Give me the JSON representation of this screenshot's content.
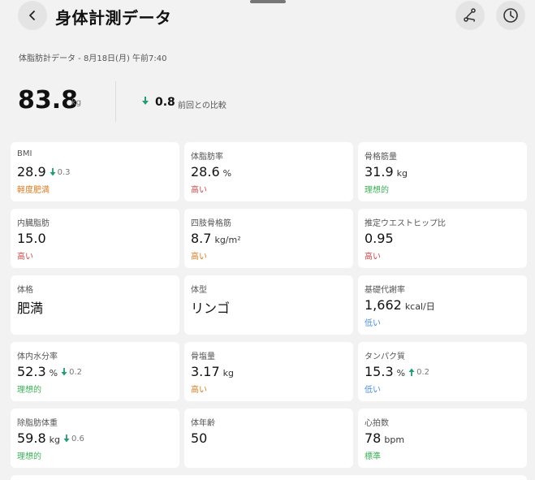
{
  "header": {
    "title": "身体計測データ",
    "back_icon": "chevron-left-icon",
    "route_icon": "route-icon",
    "history_icon": "history-icon"
  },
  "subtitle": "体脂肪計データ - 8月18日(月) 午前7:40",
  "summary": {
    "weight": "83.8",
    "unit": "kg",
    "diff": "0.8",
    "diff_direction": "down",
    "diff_label": "前回との比較"
  },
  "colors": {
    "orange": "#e07b1f",
    "red": "#d64545",
    "green": "#3daf58",
    "blue": "#4a90d9",
    "arrow_green": "#1d9e75"
  },
  "metrics": [
    {
      "label": "BMI",
      "value": "28.9",
      "unit": "",
      "change": "0.3",
      "change_dir": "down",
      "status": "軽度肥満",
      "status_color": "#e07b1f"
    },
    {
      "label": "体脂肪率",
      "value": "28.6",
      "unit": "%",
      "change": "",
      "change_dir": "",
      "status": "高い",
      "status_color": "#d64545"
    },
    {
      "label": "骨格筋量",
      "value": "31.9",
      "unit": "kg",
      "change": "",
      "change_dir": "",
      "status": "理想的",
      "status_color": "#3daf58"
    },
    {
      "label": "内臓脂肪",
      "value": "15.0",
      "unit": "",
      "change": "",
      "change_dir": "",
      "status": "高い",
      "status_color": "#d64545"
    },
    {
      "label": "四肢骨格筋",
      "value": "8.7",
      "unit": "kg/m²",
      "change": "",
      "change_dir": "",
      "status": "高い",
      "status_color": "#e07b1f"
    },
    {
      "label": "推定ウエストヒップ比",
      "value": "0.95",
      "unit": "",
      "change": "",
      "change_dir": "",
      "status": "高い",
      "status_color": "#d64545"
    },
    {
      "label": "体格",
      "value": "肥満",
      "unit": "",
      "change": "",
      "change_dir": "",
      "status": "",
      "status_color": ""
    },
    {
      "label": "体型",
      "value": "リンゴ",
      "unit": "",
      "change": "",
      "change_dir": "",
      "status": "",
      "status_color": ""
    },
    {
      "label": "基礎代謝率",
      "value": "1,662",
      "unit": "kcal/日",
      "change": "",
      "change_dir": "",
      "status": "低い",
      "status_color": "#4a90d9"
    },
    {
      "label": "体内水分率",
      "value": "52.3",
      "unit": "%",
      "change": "0.2",
      "change_dir": "down",
      "status": "理想的",
      "status_color": "#3daf58"
    },
    {
      "label": "骨塩量",
      "value": "3.17",
      "unit": "kg",
      "change": "",
      "change_dir": "",
      "status": "高い",
      "status_color": "#e07b1f"
    },
    {
      "label": "タンパク質",
      "value": "15.3",
      "unit": "%",
      "change": "0.2",
      "change_dir": "up",
      "status": "低い",
      "status_color": "#4a90d9"
    },
    {
      "label": "除脂肪体重",
      "value": "59.8",
      "unit": "kg",
      "change": "0.6",
      "change_dir": "down",
      "status": "理想的",
      "status_color": "#3daf58"
    },
    {
      "label": "体年齢",
      "value": "50",
      "unit": "",
      "change": "",
      "change_dir": "",
      "status": "",
      "status_color": ""
    },
    {
      "label": "心拍数",
      "value": "78",
      "unit": "bpm",
      "change": "",
      "change_dir": "",
      "status": "標準",
      "status_color": "#3daf58"
    }
  ]
}
